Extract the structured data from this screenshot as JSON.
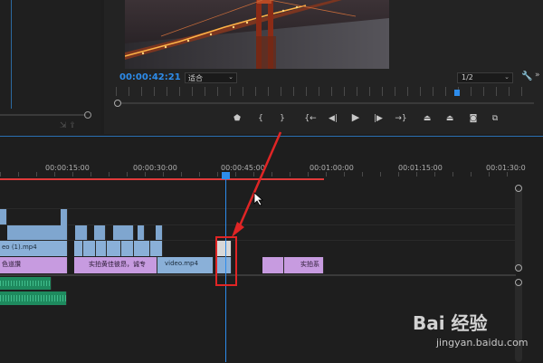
{
  "program_monitor": {
    "timecode": "00:00:42:21",
    "fit_select": "适合",
    "resolution_select": "1/2"
  },
  "transport_icons": {
    "marker": "marker-icon",
    "mark_in": "mark-in-icon",
    "mark_out": "mark-out-icon",
    "go_to_in": "go-to-in-icon",
    "step_back": "step-back-icon",
    "play": "play-icon",
    "step_forward": "step-forward-icon",
    "go_to_out": "go-to-out-icon",
    "lift": "lift-icon",
    "extract": "extract-icon",
    "export_frame": "camera-icon",
    "button_editor": "button-editor-icon"
  },
  "timeline": {
    "ruler_labels": [
      "00:00:15:00",
      "00:00:30:00",
      "00:00:45:00",
      "00:01:00:00",
      "00:01:15:00",
      "00:01:30:0"
    ],
    "playhead_time": "00:00:42:21",
    "clip_labels": {
      "v1_left": "eo (1).mp4",
      "v2_left": "色道讚",
      "v2_middle": "实拍黄佳彼昂，诚专",
      "v2_video": "video.mp4",
      "v2_right": "实拍系"
    }
  },
  "watermark": {
    "brand": "Bai 经验",
    "url": "jingyan.baidu.com"
  },
  "colors": {
    "accent_blue": "#2d8ceb",
    "annotation_red": "#e02525",
    "video_clip": "#8ab0d8",
    "nested_clip": "#c79be0",
    "audio_clip": "#1e8a5e"
  }
}
